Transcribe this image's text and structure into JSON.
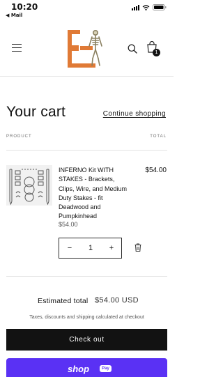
{
  "status_bar": {
    "time": "10:20",
    "back_label": "◀ Mail",
    "icons": [
      "signal-icon",
      "wifi-icon",
      "battery-icon"
    ]
  },
  "header": {
    "icons": [
      "menu-icon",
      "skeleton-logo",
      "search-icon",
      "cart-icon"
    ],
    "cart_count": "1"
  },
  "cart": {
    "title": "Your cart",
    "continue_label": "Continue shopping",
    "col_product": "PRODUCT",
    "col_total": "TOTAL",
    "items": [
      {
        "title": "INFERNO Kit WITH STAKES - Brackets, Clips, Wire, and Medium Duty Stakes - fit Deadwood and Pumpkinhead",
        "unit_price": "$54.00",
        "quantity": "1",
        "total": "$54.00"
      }
    ],
    "qty_minus": "−",
    "qty_plus": "+"
  },
  "summary": {
    "estimated_label": "Estimated total",
    "estimated_value": "$54.00 USD",
    "tax_note": "Taxes, discounts and shipping calculated at checkout",
    "checkout_label": "Check out",
    "shoppay_label": "shop",
    "shoppay_pill": "Pay"
  },
  "colors": {
    "text": "#121212",
    "checkout_bg": "#121212",
    "shoppay_bg": "#5a31f4",
    "logo_orange": "#e07a36"
  }
}
